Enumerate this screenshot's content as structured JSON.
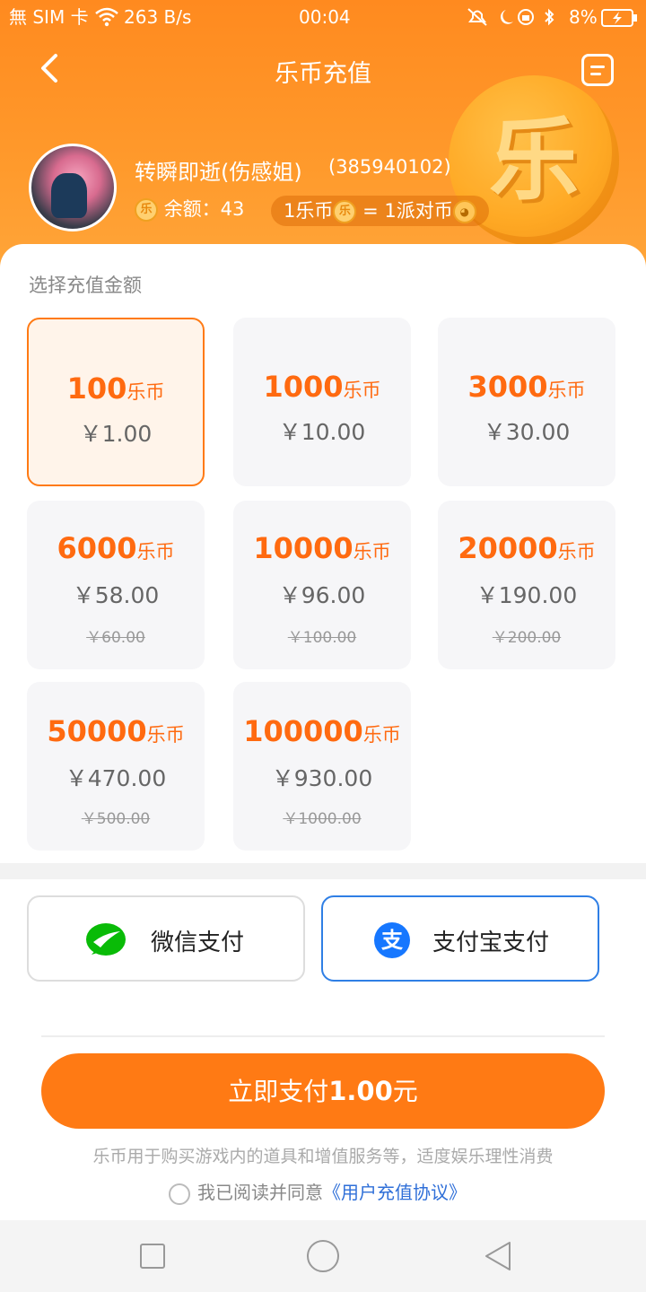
{
  "status_bar": {
    "left": "無 SIM 卡",
    "speed": "263 B/s",
    "time": "00:04",
    "battery": "8%"
  },
  "header": {
    "title": "乐币充值",
    "coin_glyph": "乐"
  },
  "user": {
    "name": "转瞬即逝(伤感姐)",
    "id": "(385940102)",
    "balance_label": "余额：43",
    "rate_part1": "1乐币",
    "rate_part2": "= 1派对币"
  },
  "section_title": "选择充值金额",
  "unit": "乐币",
  "packages": [
    {
      "coins": "100",
      "price": "￥1.00",
      "orig": ""
    },
    {
      "coins": "1000",
      "price": "￥10.00",
      "orig": ""
    },
    {
      "coins": "3000",
      "price": "￥30.00",
      "orig": ""
    },
    {
      "coins": "6000",
      "price": "￥58.00",
      "orig": "￥60.00"
    },
    {
      "coins": "10000",
      "price": "￥96.00",
      "orig": "￥100.00"
    },
    {
      "coins": "20000",
      "price": "￥190.00",
      "orig": "￥200.00"
    },
    {
      "coins": "50000",
      "price": "￥470.00",
      "orig": "￥500.00"
    },
    {
      "coins": "100000",
      "price": "￥930.00",
      "orig": "￥1000.00"
    }
  ],
  "payment": {
    "wechat": "微信支付",
    "alipay": "支付宝支付",
    "selected": "alipay"
  },
  "pay_button": {
    "prefix": "立即支付",
    "amount": "1.00",
    "suffix": "元"
  },
  "notice": "乐币用于购买游戏内的道具和增值服务等，适度娱乐理性消费",
  "agreement": {
    "text": "我已阅读并同意",
    "link": "《用户充值协议》"
  },
  "colors": {
    "accent": "#ff7a14",
    "alipay": "#1677ff",
    "wechat": "#09bb07"
  }
}
